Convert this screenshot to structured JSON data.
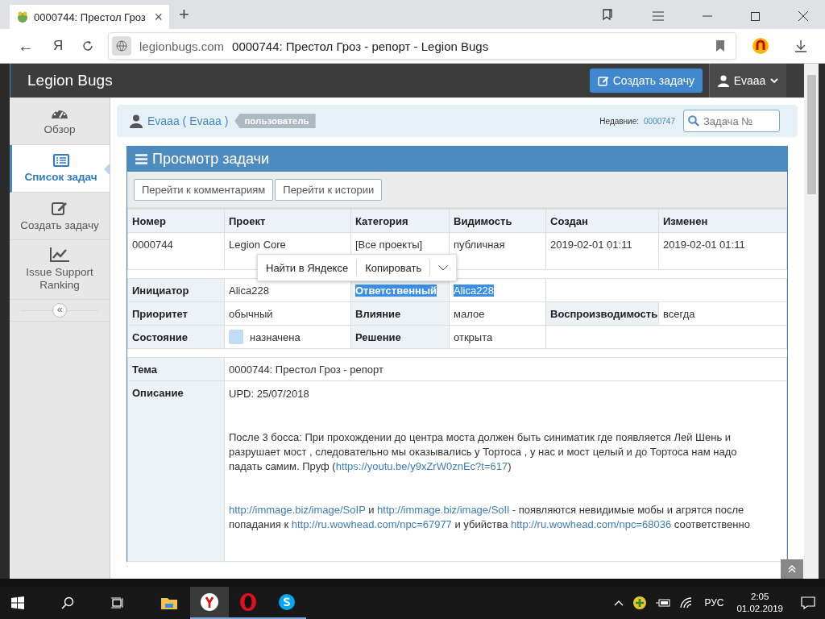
{
  "browser": {
    "tab_title": "0000744: Престол Гроз ",
    "tab_close": "×",
    "new_tab": "+",
    "domain": "legionbugs.com",
    "page_title": "0000744: Престол Гроз - репорт - Legion Bugs",
    "back": "←",
    "home": "Я"
  },
  "header": {
    "brand": "Legion Bugs",
    "create_button": "Создать задачу",
    "user_menu": "Evaaa"
  },
  "sidebar": {
    "items": [
      {
        "label": "Обзор",
        "kind": "gauge",
        "selected": false
      },
      {
        "label": "Список задач",
        "kind": "list",
        "selected": true
      },
      {
        "label": "Создать задачу",
        "kind": "edit",
        "selected": false
      },
      {
        "label": "Issue Support Ranking",
        "kind": "chart",
        "selected": false
      }
    ],
    "collapse": "«"
  },
  "info_bar": {
    "user": "Evaaa ( Evaaa )",
    "role": "пользователь",
    "recent_label": "Недавние:",
    "recent_link": "0000747",
    "search_placeholder": "Задача №"
  },
  "panel": {
    "title": "Просмотр задачи",
    "buttons": [
      "Перейти к комментариям",
      "Перейти к истории"
    ]
  },
  "table": {
    "columns": [
      "Номер",
      "Проект",
      "Категория",
      "Видимость",
      "Создан",
      "Изменен"
    ],
    "row": [
      "0000744",
      "Legion Core",
      "[Все проекты]",
      "публичная",
      "2019-02-01 01:11",
      "2019-02-01 01:11"
    ]
  },
  "details": [
    [
      {
        "kind": "label",
        "text": "Инициатор",
        "selected": false
      },
      {
        "kind": "value",
        "text": "Alica228",
        "selected": false
      },
      {
        "kind": "label",
        "text": "Ответственный",
        "selected": true
      },
      {
        "kind": "value",
        "text": "Alica228",
        "selected": true
      },
      {
        "kind": "empty"
      }
    ],
    [
      {
        "kind": "label",
        "text": "Приоритет",
        "selected": false
      },
      {
        "kind": "value",
        "text": "обычный",
        "selected": false
      },
      {
        "kind": "label",
        "text": "Влияние",
        "selected": false
      },
      {
        "kind": "value",
        "text": "малое",
        "selected": false
      },
      {
        "kind": "label",
        "text": "Воспроизводимость",
        "selected": false
      },
      {
        "kind": "value",
        "text": "всегда",
        "selected": false
      }
    ],
    [
      {
        "kind": "label",
        "text": "Состояние",
        "selected": false
      },
      {
        "kind": "status",
        "text": "назначена",
        "color": "#c2dcf6",
        "selected": false
      },
      {
        "kind": "label",
        "text": "Решение",
        "selected": false
      },
      {
        "kind": "value",
        "text": "открыта",
        "selected": false
      },
      {
        "kind": "empty"
      }
    ]
  ],
  "summary": {
    "label": "Тема",
    "text": "0000744: Престол Гроз - репорт"
  },
  "description": {
    "label": "Описание",
    "paragraphs": [
      [
        {
          "kind": "text",
          "text": "UPD: 25/07/2018"
        }
      ],
      [
        {
          "kind": "text",
          "text": "После 3 босса: При прохождении до центра моста должен быть синиматик где появляется Лей Шень и разрушает мост , следовательно мы оказывались у Тортоса , у нас и мост целый и до Тортоса нам надо падать самим. Пруф ("
        },
        {
          "kind": "link",
          "text": "https://youtu.be/y9xZrW0znEc?t=617"
        },
        {
          "kind": "text",
          "text": ")"
        }
      ],
      [
        {
          "kind": "link",
          "text": "http://immage.biz/image/SoIP"
        },
        {
          "kind": "text",
          "text": " и "
        },
        {
          "kind": "link",
          "text": "http://immage.biz/image/SoIl"
        },
        {
          "kind": "text",
          "text": " - появляются невидимые мобы и агрятся после попадания к "
        },
        {
          "kind": "link",
          "text": "http://ru.wowhead.com/npc=67977"
        },
        {
          "kind": "text",
          "text": " и убийства "
        },
        {
          "kind": "link",
          "text": "http://ru.wowhead.com/npc=68036"
        },
        {
          "kind": "text",
          "text": " соответственно"
        }
      ]
    ]
  },
  "context_menu": {
    "items": [
      "Найти в Яндексе",
      "Копировать"
    ]
  },
  "taskbar": {
    "language": "РУС",
    "time": "2:05",
    "date": "01.02.2019"
  }
}
